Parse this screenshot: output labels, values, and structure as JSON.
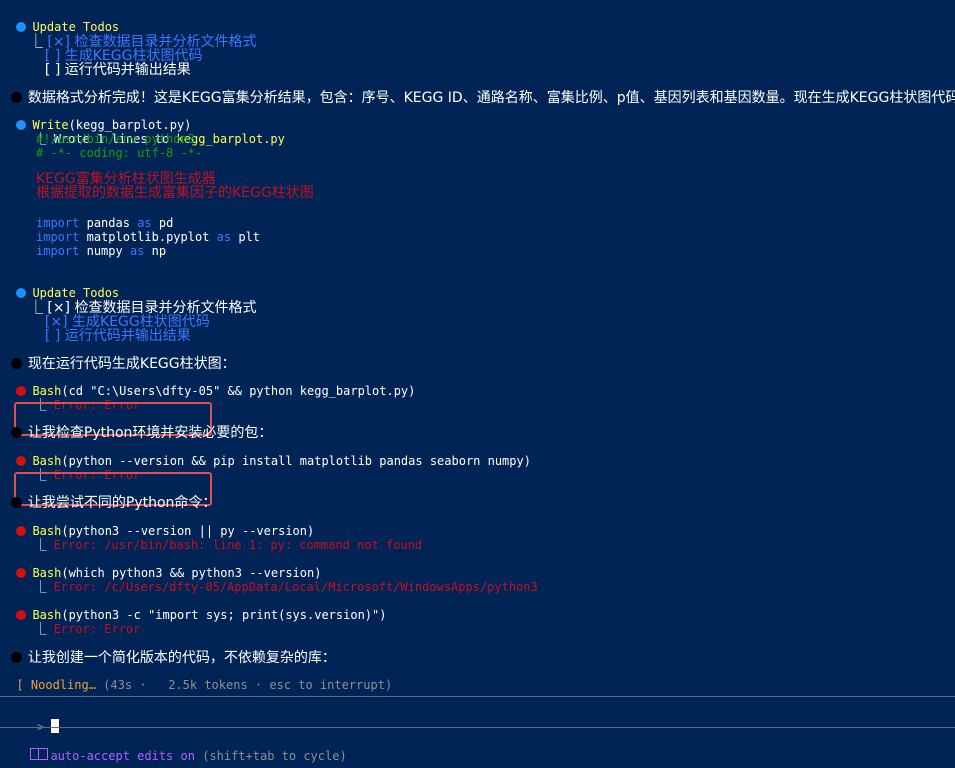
{
  "todos1": {
    "title": "Update Todos",
    "items": [
      {
        "box": "[×]",
        "label": "检查数据目录并分析文件格式"
      },
      {
        "box": "[ ]",
        "label": "生成KEGG柱状图代码"
      },
      {
        "box": "[ ]",
        "label": "运行代码并输出结果"
      }
    ]
  },
  "msg1": "数据格式分析完成！这是KEGG富集分析结果，包含：序号、KEGG ID、通路名称、富集比例、p值、基因列表和基因数量。现在生成KEGG柱状图代码：",
  "write": {
    "tool": "Write",
    "arg": "(kegg_barplot.py)",
    "result_prefix": "Wrote 1 lines to ",
    "result_file": "kegg_barplot.py",
    "code": [
      "#!/usr/bin/env python3",
      "# -*- coding: utf-8 -*-",
      "",
      "KEGG富集分析柱状图生成器",
      "根据提取的数据生成富集因子的KEGG柱状图",
      "",
      "import pandas as pd",
      "import matplotlib.pyplot as plt",
      "import numpy as np"
    ]
  },
  "todos2": {
    "title": "Update Todos",
    "items": [
      {
        "box": "[×]",
        "label": "检查数据目录并分析文件格式"
      },
      {
        "box": "[×]",
        "label": "生成KEGG柱状图代码"
      },
      {
        "box": "[ ]",
        "label": "运行代码并输出结果"
      }
    ]
  },
  "msg2": "现在运行代码生成KEGG柱状图：",
  "bash1": {
    "tool": "Bash",
    "arg": "(cd \"C:\\Users\\dfty-05\" && python kegg_barplot.py)",
    "result": "Error: Error"
  },
  "msg3": "让我检查Python环境并安装必要的包：",
  "bash2": {
    "tool": "Bash",
    "arg": "(python --version && pip install matplotlib pandas seaborn numpy)",
    "result": "Error: Error"
  },
  "msg4": "让我尝试不同的Python命令：",
  "bash3": {
    "tool": "Bash",
    "arg": "(python3 --version || py --version)",
    "result": "Error: /usr/bin/bash: line 1: py: command not found"
  },
  "bash4": {
    "tool": "Bash",
    "arg": "(which python3 && python3 --version)",
    "result": "Error: /c/Users/dfty-05/AppData/Local/Microsoft/WindowsApps/python3"
  },
  "bash5": {
    "tool": "Bash",
    "arg": "(python3 -c \"import sys; print(sys.version)\")",
    "result": "Error: Error"
  },
  "msg5": "让我创建一个简化版本的代码，不依赖复杂的库：",
  "status": {
    "spinner": "[",
    "word": "Noodling…",
    "details": "(43s ·   2.5k tokens · esc to interrupt)"
  },
  "prompt": {
    "symbol": ">"
  },
  "footer": {
    "mode": "auto-accept edits on",
    "hint": "(shift+tab to cycle)"
  },
  "colors": {
    "background": "#012456",
    "tool": "#ffff55",
    "error": "#c50f1f",
    "highlight": "#e05050"
  }
}
